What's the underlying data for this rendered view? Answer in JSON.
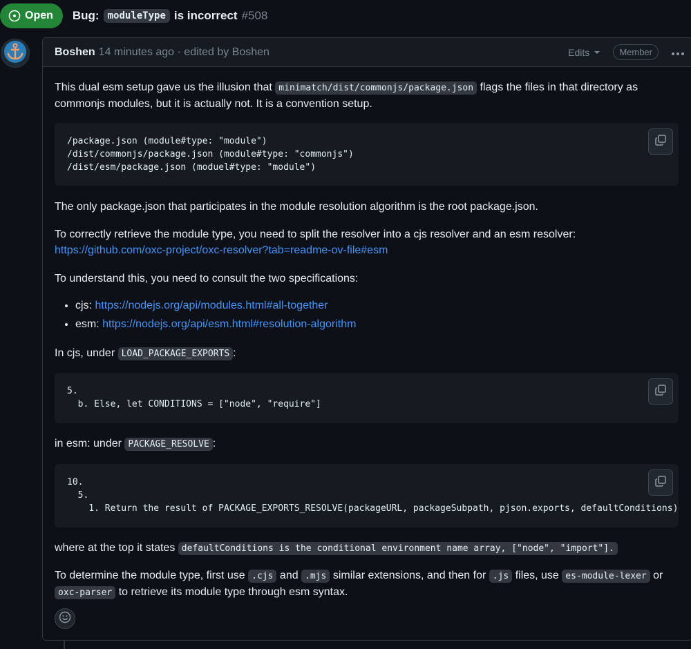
{
  "issue": {
    "state": "Open",
    "title_prefix": "Bug:",
    "title_code": "moduleType",
    "title_suffix": "is incorrect",
    "number": "#508"
  },
  "comment": {
    "author": "Boshen",
    "meta": "14 minutes ago · edited by Boshen",
    "edits_label": "Edits",
    "role_badge": "Member",
    "p1_before": "This dual esm setup gave us the illusion that",
    "p1_code": "minimatch/dist/commonjs/package.json",
    "p1_after": "flags the files in that directory as",
    "p1_line2": "commonjs modules, but it is actually not. It is a convention setup.",
    "code1": "/package.json (module#type: \"module\")\n/dist/commonjs/package.json (module#type: \"commonjs\")\n/dist/esm/package.json (moduel#type: \"module\")",
    "p2": "The only package.json that participates in the module resolution algorithm is the root package.json.",
    "p3": "To correctly retrieve the module type, you need to split the resolver into a cjs resolver and an esm resolver:",
    "p3_link": "https://github.com/oxc-project/oxc-resolver?tab=readme-ov-file#esm",
    "p4": "To understand this, you need to consult the two specifications:",
    "list": [
      {
        "label": "cjs:",
        "link": "https://nodejs.org/api/modules.html#all-together"
      },
      {
        "label": "esm:",
        "link": "https://nodejs.org/api/esm.html#resolution-algorithm"
      }
    ],
    "p5_before": "In cjs, under",
    "p5_code": "LOAD_PACKAGE_EXPORTS",
    "p5_after": ":",
    "code2": "5.\n  b. Else, let CONDITIONS = [\"node\", \"require\"]",
    "p6_before": "in esm: under",
    "p6_code": "PACKAGE_RESOLVE",
    "p6_after": ":",
    "code3": "10.\n  5.\n    1. Return the result of PACKAGE_EXPORTS_RESOLVE(packageURL, packageSubpath, pjson.exports, defaultConditions)",
    "p7_before": "where at the top it states",
    "p7_code": "defaultConditions is the conditional environment name array, [\"node\", \"import\"].",
    "p8_1": "To determine the module type, first use",
    "p8_c1": ".cjs",
    "p8_2": "and",
    "p8_c2": ".mjs",
    "p8_3": "similar extensions, and then for",
    "p8_c3": ".js",
    "p8_4": "files, use",
    "p8_c4": "es-module-lexer",
    "p8_5": "or",
    "p8_c5": "oxc-parser",
    "p8_6": "to retrieve its module type through esm syntax."
  },
  "colors": {
    "background": "#0d1117",
    "open_badge": "#238636",
    "link": "#4493f8",
    "muted": "#7d8590"
  },
  "icons": [
    "issue-open-icon",
    "anchor-avatar-icon",
    "chevron-down-icon",
    "kebab-icon",
    "copy-icon",
    "smiley-icon"
  ]
}
